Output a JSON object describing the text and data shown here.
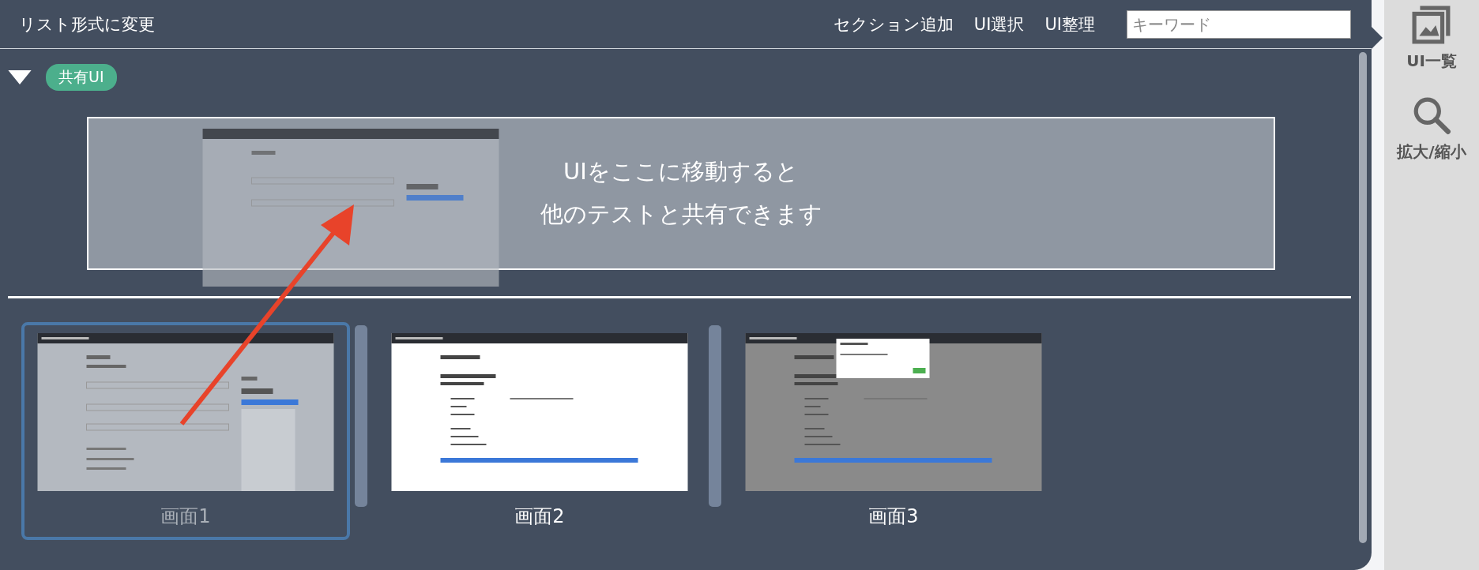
{
  "toolbar": {
    "toggle_label": "リスト形式に変更",
    "actions": [
      "セクション追加",
      "UI選択",
      "UI整理"
    ],
    "search": {
      "placeholder": "キーワード"
    }
  },
  "section": {
    "expanded": true,
    "badge": "共有UI",
    "drop_zone": {
      "lines": [
        "UIをここに移動すると",
        "他のテストと共有できます"
      ]
    }
  },
  "screens": [
    {
      "label": "画面1",
      "kind": "form",
      "selected": true
    },
    {
      "label": "画面2",
      "kind": "confirm",
      "selected": false
    },
    {
      "label": "画面3",
      "kind": "modal",
      "selected": false
    }
  ],
  "sidebar": {
    "items": [
      {
        "label": "UI一覧",
        "kind": "list"
      },
      {
        "label": "拡大/縮小",
        "kind": "zoom"
      }
    ]
  }
}
